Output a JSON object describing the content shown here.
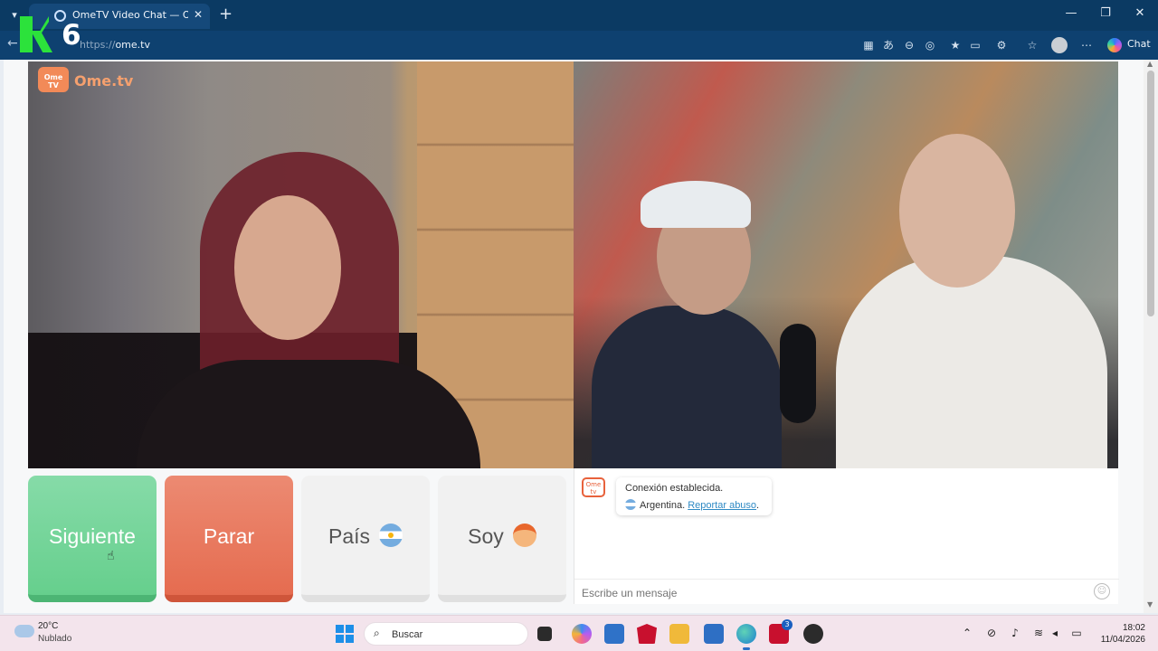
{
  "browser": {
    "tab_title": "OmeTV Video Chat — Omegl",
    "url_scheme": "https://",
    "url_host": "ome.tv",
    "chat_label": "Chat"
  },
  "overlay": {
    "channel_number": "6"
  },
  "site": {
    "brand_badge": "Ome TV",
    "brand_name": "Ome.tv"
  },
  "controls": {
    "next_label": "Siguiente",
    "stop_label": "Parar",
    "country_label": "País",
    "gender_label": "Soy"
  },
  "chat": {
    "logo_text": "Ome tv",
    "connection_status": "Conexión establecida.",
    "country": "Argentina.",
    "report_link": "Reportar abuso",
    "input_placeholder": "Escribe un mensaje"
  },
  "taskbar": {
    "temperature": "20°C",
    "condition": "Nublado",
    "search_placeholder": "Buscar",
    "time": "18:02",
    "date": "11/04/2026",
    "lastpass_badge": "3"
  },
  "colors": {
    "next_green": "#66cf8d",
    "stop_red": "#e56c50",
    "brand_orange": "#f28a58",
    "browser_blue": "#0b3a63"
  }
}
